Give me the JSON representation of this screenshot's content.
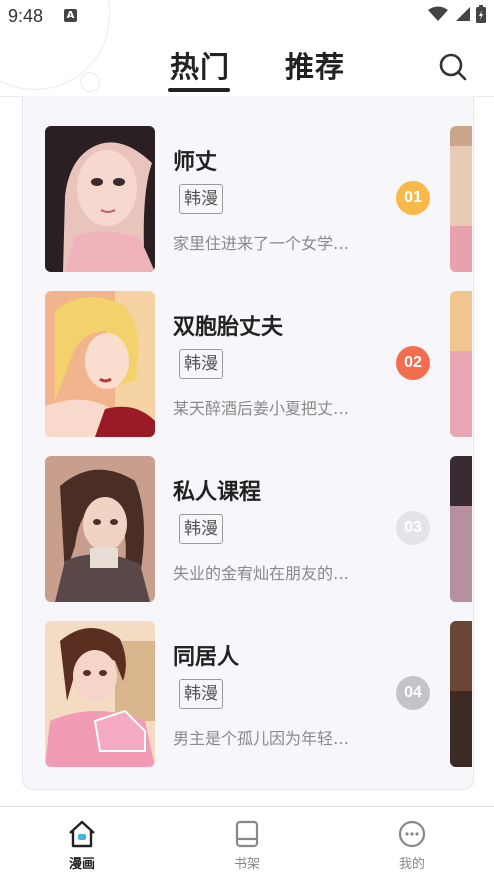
{
  "status_bar": {
    "time": "9:48",
    "notification_letter": "A",
    "icons": [
      "wifi-icon",
      "signal-icon",
      "battery-charging-icon"
    ]
  },
  "header": {
    "tabs": [
      {
        "label": "热门",
        "active": true
      },
      {
        "label": "推荐",
        "active": false
      }
    ],
    "search_icon": "search-icon"
  },
  "list": {
    "items": [
      {
        "title": "师丈",
        "tag": "韩漫",
        "desc": "家里住进来了一个女学…",
        "rank": "01",
        "rank_color": "#f9b84a"
      },
      {
        "title": "双胞胎丈夫",
        "tag": "韩漫",
        "desc": "某天醉酒后姜小夏把丈…",
        "rank": "02",
        "rank_color": "#f46d4e"
      },
      {
        "title": "私人课程",
        "tag": "韩漫",
        "desc": "失业的金宥灿在朋友的…",
        "rank": "03",
        "rank_color": "#e4e4e8"
      },
      {
        "title": "同居人",
        "tag": "韩漫",
        "desc": "男主是个孤儿因为年轻…",
        "rank": "04",
        "rank_color": "#c3c3c8"
      }
    ]
  },
  "bottom_nav": {
    "items": [
      {
        "label": "漫画",
        "icon": "home-icon",
        "active": true
      },
      {
        "label": "书架",
        "icon": "book-icon",
        "active": false
      },
      {
        "label": "我的",
        "icon": "profile-face-icon",
        "active": false
      }
    ]
  }
}
